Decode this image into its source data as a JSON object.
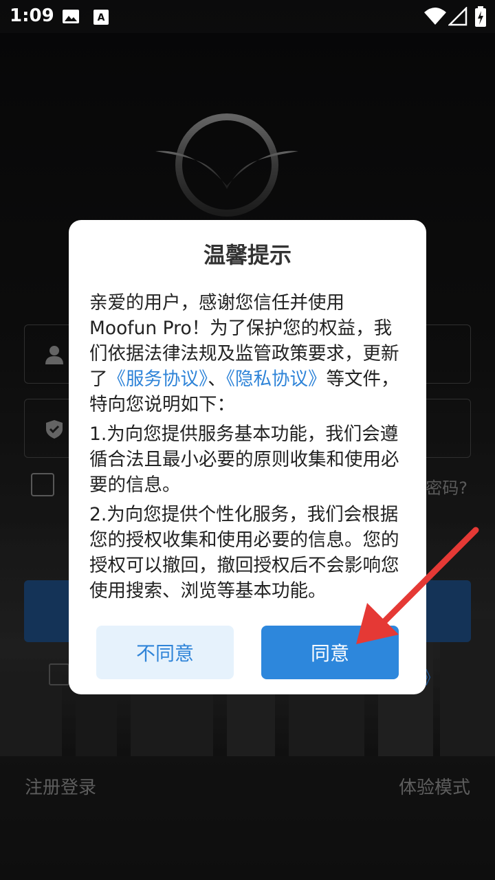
{
  "status_bar": {
    "time": "1:09"
  },
  "background": {
    "forgot_password": "忘记密码?",
    "agreement_suffix": "》",
    "register_login": "注册登录",
    "trial_mode": "体验模式"
  },
  "dialog": {
    "title": "温馨提示",
    "para1_prefix": "亲爱的用户，感谢您信任并使用Moofun Pro！为了保护您的权益，我们依据法律法规及监管政策要求，更新了",
    "service_agreement": "《服务协议》",
    "separator": "、",
    "privacy_agreement": "《隐私协议》",
    "para1_suffix": "等文件，特向您说明如下：",
    "item1": "1.为向您提供服务基本功能，我们会遵循合法且最小必要的原则收集和使用必要的信息。",
    "item2": "2.为向您提供个性化服务，我们会根据您的授权收集和使用必要的信息。您的授权可以撤回，撤回授权后不会影响您使用搜索、浏览等基本功能。",
    "disagree": "不同意",
    "agree": "同意"
  },
  "colors": {
    "accent": "#2d87dc",
    "link": "#2f84d8",
    "arrow": "#e53935"
  }
}
